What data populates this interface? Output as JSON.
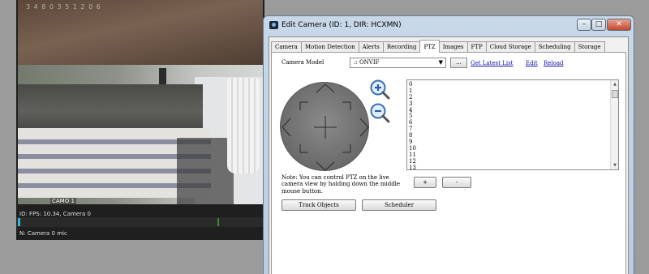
{
  "camera_panel": {
    "top_text": "3 4 8 0 3 5 1 2 0 6",
    "overlay_label": "CAMO 1",
    "status": "ID: FPS: 10.34, Camera 0",
    "footer": "N: Camera 0 mic"
  },
  "dialog": {
    "title": "Edit Camera (ID: 1, DIR: HCXMN)",
    "window_buttons": {
      "minimize": "–",
      "maximize": "□",
      "close": "✕"
    },
    "tabs": [
      "Camera",
      "Motion Detection",
      "Alerts",
      "Recording",
      "PTZ",
      "Images",
      "FTP",
      "Cloud Storage",
      "Scheduling",
      "Storage"
    ],
    "active_tab": "PTZ",
    "ptz": {
      "camera_model_label": "Camera Model",
      "camera_model_value": ":: ONVIF",
      "dots_label": "...",
      "get_latest_list": "Get Latest List",
      "edit": "Edit",
      "reload": "Reload",
      "presets": [
        "0",
        "1",
        "2",
        "3",
        "4",
        "5",
        "6",
        "7",
        "8",
        "9",
        "10",
        "11",
        "12",
        "13"
      ],
      "note": "Note: You can control PTZ on the live camera view by holding down the middle mouse button.",
      "plus_label": "+",
      "minus_label": "-",
      "track_objects": "Track Objects",
      "scheduler": "Scheduler"
    }
  }
}
